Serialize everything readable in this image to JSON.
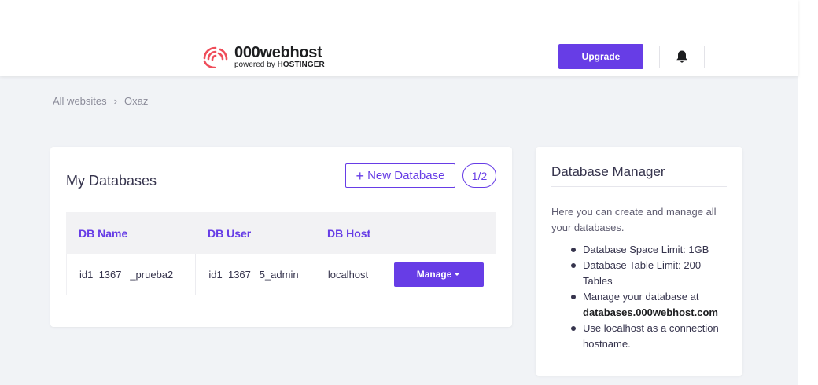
{
  "header": {
    "logo": {
      "name": "000webhost",
      "tagline_prefix": "powered by",
      "tagline_brand": "HOSTINGER"
    },
    "upgrade_label": "Upgrade",
    "bell_icon": "bell-icon"
  },
  "breadcrumb": {
    "root": "All websites",
    "separator": "›",
    "current": "Oxaz"
  },
  "databases": {
    "title": "My Databases",
    "new_button_label": "New Database",
    "count": "1/2",
    "columns": [
      "DB Name",
      "DB User",
      "DB Host"
    ],
    "rows": [
      {
        "name": "id1  1367   _prueba2",
        "user": "id1  1367   5_admin",
        "host": "localhost",
        "action": "Manage"
      }
    ]
  },
  "manager": {
    "title": "Database Manager",
    "description": "Here you can create and manage all your databases.",
    "items": [
      "Database Space Limit: 1GB",
      "Database Table Limit: 200 Tables",
      "Manage your database at",
      "databases.000webhost.com",
      "Use localhost as a connection hostname."
    ]
  },
  "colors": {
    "accent": "#673de6",
    "background": "#f1f3f6",
    "logo_red": "#ef4d5a"
  }
}
